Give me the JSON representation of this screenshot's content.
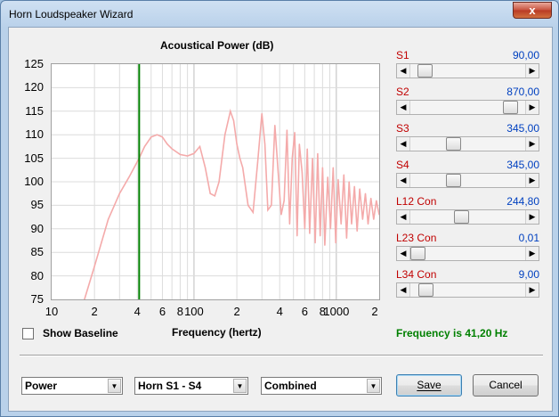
{
  "window": {
    "title": "Horn Loudspeaker Wizard",
    "close_glyph": "x"
  },
  "chart": {
    "title": "Acoustical Power (dB)",
    "xlabel": "Frequency (hertz)",
    "y_ticks": [
      "125",
      "120",
      "115",
      "110",
      "105",
      "100",
      "95",
      "90",
      "85",
      "80",
      "75"
    ],
    "x_ticks": [
      "10",
      "2",
      "4",
      "6",
      "8",
      "100",
      "2",
      "4",
      "6",
      "8",
      "1000",
      "2"
    ],
    "marker_frequency_hz": 41.2,
    "series_color": "#f4aaaa",
    "marker_color": "#008000"
  },
  "chart_data": {
    "type": "line",
    "title": "Acoustical Power (dB)",
    "xlabel": "Frequency (hertz)",
    "ylabel": "",
    "xscale": "log",
    "xlim": [
      10,
      2000
    ],
    "ylim": [
      75,
      125
    ],
    "x": [
      17,
      20,
      25,
      30,
      35,
      41.2,
      45,
      50,
      55,
      60,
      65,
      70,
      80,
      90,
      100,
      110,
      120,
      130,
      140,
      150,
      165,
      180,
      190,
      200,
      210,
      220,
      240,
      260,
      280,
      300,
      315,
      330,
      350,
      370,
      390,
      410,
      430,
      450,
      470,
      490,
      510,
      530,
      550,
      575,
      600,
      625,
      650,
      680,
      710,
      740,
      770,
      800,
      830,
      870,
      910,
      950,
      990,
      1030,
      1080,
      1130,
      1180,
      1230,
      1280,
      1340,
      1400,
      1460,
      1530,
      1600,
      1670,
      1750,
      1830,
      1910,
      2000
    ],
    "series": [
      {
        "values": [
          75,
          82,
          92,
          97.5,
          101,
          105,
          107.5,
          109.5,
          110,
          109.5,
          108,
          107,
          105.8,
          105.5,
          106,
          107.5,
          103,
          97.5,
          97,
          100,
          110,
          115,
          113,
          108,
          105,
          103,
          95,
          93.5,
          104,
          114.5,
          108,
          94,
          95,
          112,
          102,
          93,
          96,
          111,
          91,
          105,
          110.5,
          88.5,
          108,
          102,
          90,
          107,
          89,
          105,
          87,
          106,
          88.5,
          103,
          86.5,
          101,
          90,
          103,
          87,
          100.5,
          91,
          101.5,
          88,
          100,
          91,
          99,
          89.5,
          98.5,
          92,
          97.5,
          91,
          96.5,
          92,
          96,
          93
        ]
      }
    ],
    "grid": true,
    "legend": "none"
  },
  "options": {
    "show_baseline_label": "Show Baseline",
    "show_baseline_checked": false
  },
  "status": {
    "frequency_text": "Frequency is 41,20 Hz"
  },
  "params": [
    {
      "label": "S1",
      "value": "90,00",
      "position": 0.07
    },
    {
      "label": "S2",
      "value": "870,00",
      "position": 0.93
    },
    {
      "label": "S3",
      "value": "345,00",
      "position": 0.36
    },
    {
      "label": "S4",
      "value": "345,00",
      "position": 0.36
    },
    {
      "label": "L12 Con",
      "value": "244,80",
      "position": 0.44
    },
    {
      "label": "L23 Con",
      "value": "0,01",
      "position": 0.0
    },
    {
      "label": "L34 Con",
      "value": "9,00",
      "position": 0.08
    }
  ],
  "dropdowns": [
    {
      "value": "Power"
    },
    {
      "value": "Horn S1 - S4"
    },
    {
      "value": "Combined"
    }
  ],
  "buttons": {
    "save": "Save",
    "cancel": "Cancel"
  }
}
